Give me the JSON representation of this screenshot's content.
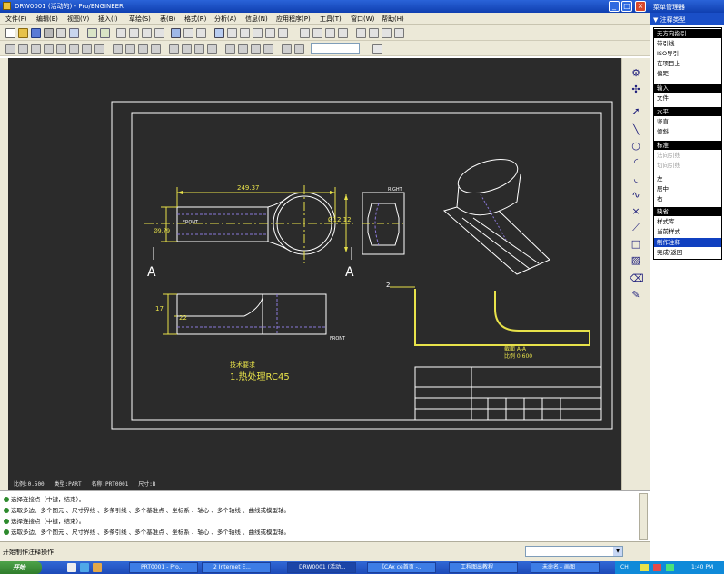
{
  "window": {
    "title": "DRW0001 (活动的) - Pro/ENGINEER",
    "minimize": "_",
    "maximize": "□",
    "close": "×"
  },
  "menubar": {
    "items": [
      "文件(F)",
      "编辑(E)",
      "视图(V)",
      "插入(I)",
      "草绘(S)",
      "表(B)",
      "格式(R)",
      "分析(A)",
      "信息(N)",
      "应用程序(P)",
      "工具(T)",
      "窗口(W)",
      "帮助(H)"
    ]
  },
  "toolbar": {
    "scale_value": ""
  },
  "drawing": {
    "dim_length": "249.37",
    "dim_height": "Ø12.12",
    "dim_left": "Ø9.79",
    "dim_vertical": "17",
    "dim_small": "22",
    "section_left": "A",
    "section_right": "A",
    "callout": "2",
    "label_front": "FRONT",
    "label_right": "RIGHT",
    "label_top": "FRONT",
    "detail_title": "截面 A-A",
    "detail_scale": "比例 0.600",
    "tech_req_title": "技术要求",
    "tech_req_item": "1.热处理RC45",
    "status": {
      "scale": "比例:0.500",
      "type": "类型:PART",
      "name": "名称:PRT0001",
      "size": "尺寸:B"
    }
  },
  "messages": [
    "选择连接点（中键，结束）。",
    "选取多边、多个图元 、尺寸界线 、多条引线 、多个基准点 、坐标系 、轴心 、多个轴线 、曲线或模型轴。",
    "选择连接点（中键，结束）。",
    "选取多边、多个图元 、尺寸界线 、多条引线 、多个基准点 、坐标系 、轴心 、多个轴线 、曲线或模型轴。"
  ],
  "prompt": "开始制作注释操作",
  "menu_manager": {
    "title": "菜单管理器",
    "subtitle": "▼ 注释类型",
    "items": [
      {
        "label": "无方向指引",
        "style": "head"
      },
      {
        "label": "带引线",
        "style": ""
      },
      {
        "label": "ISO导引",
        "style": ""
      },
      {
        "label": "在项目上",
        "style": ""
      },
      {
        "label": "偏距",
        "style": ""
      },
      {
        "label": "输入",
        "style": "head"
      },
      {
        "label": "文件",
        "style": ""
      },
      {
        "label": "水平",
        "style": "head"
      },
      {
        "label": "竖直",
        "style": ""
      },
      {
        "label": "倾斜",
        "style": ""
      },
      {
        "label": "标准",
        "style": "head"
      },
      {
        "label": "法向引线",
        "style": "dim"
      },
      {
        "label": "切向引线",
        "style": "dim"
      },
      {
        "label": "左",
        "style": ""
      },
      {
        "label": "居中",
        "style": ""
      },
      {
        "label": "右",
        "style": ""
      },
      {
        "label": "缺省",
        "style": "head"
      },
      {
        "label": "样式库",
        "style": ""
      },
      {
        "label": "当前样式",
        "style": ""
      },
      {
        "label": "制作注释",
        "style": "sel"
      },
      {
        "label": "完成/返回",
        "style": ""
      }
    ]
  },
  "taskbar": {
    "start": "开始",
    "buttons": [
      "PRT0001 - Pro...",
      "2 Internet E...",
      "DRW0001 (活动...",
      "《CAx ce首页 -...",
      "工程图出教程",
      "未命名 - 画图"
    ],
    "tray_time": "1:40 PM",
    "tray_lang": "CH"
  },
  "colors": {
    "canvas": "#2b2b2b",
    "drawing_line": "#ffffff",
    "dimension": "#e8e24a",
    "hidden_line": "#8a78d8",
    "xp_blue": "#1f55c9"
  }
}
